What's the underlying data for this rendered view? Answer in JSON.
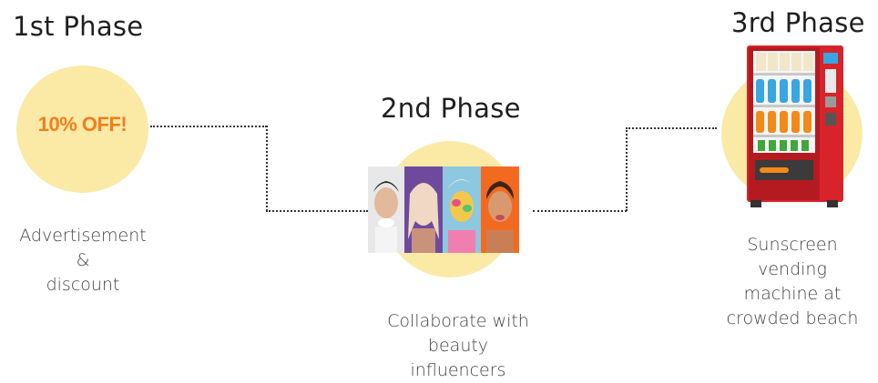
{
  "phases": [
    {
      "title": "1st Phase",
      "caption_lines": [
        "Advertisement",
        "&",
        "discount"
      ],
      "badge": "10% OFF!"
    },
    {
      "title": "2nd Phase",
      "caption_lines": [
        "Collaborate with",
        "beauty",
        "influencers"
      ]
    },
    {
      "title": "3rd Phase",
      "caption_lines": [
        "Sunscreen",
        "vending",
        "machine at",
        "crowded beach"
      ]
    }
  ],
  "colors": {
    "blob": "#fbe9a6",
    "badge": "#f07f1b",
    "vending_red": "#d8232a",
    "text": "#444444"
  },
  "icons": [
    "influencer-photo-strip",
    "vending-machine-icon"
  ]
}
